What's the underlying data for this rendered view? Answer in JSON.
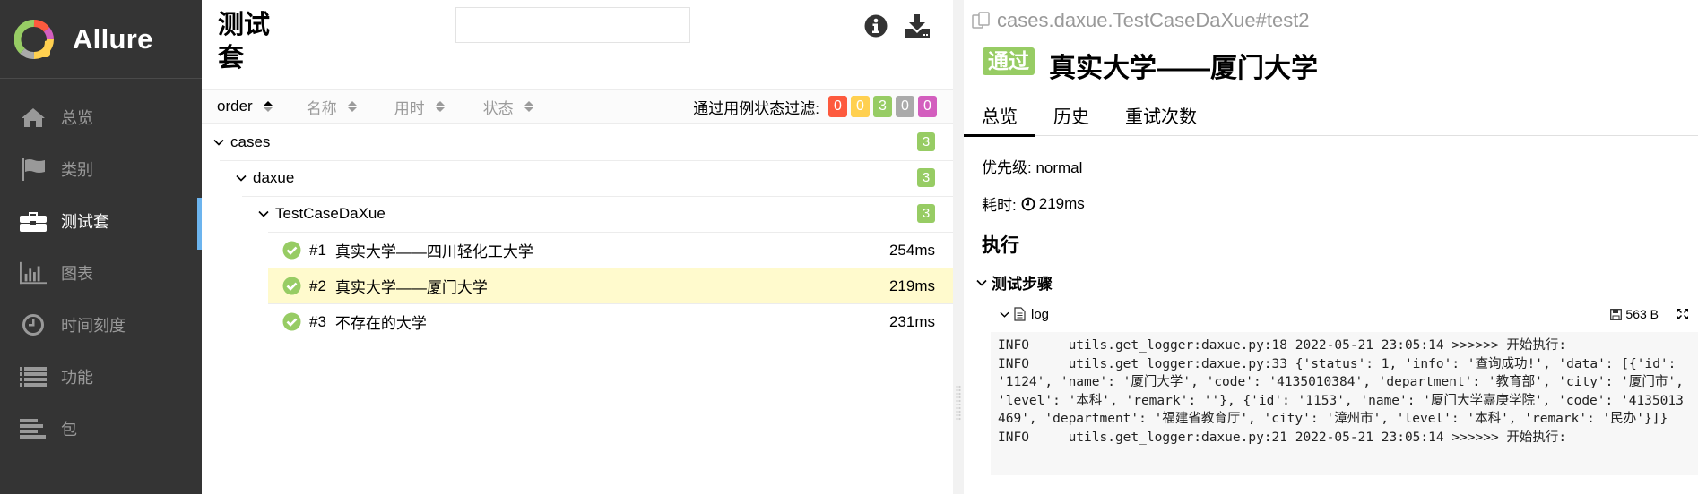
{
  "brand": {
    "name": "Allure"
  },
  "sidebar": {
    "items": [
      {
        "label": "总览",
        "icon": "home-icon"
      },
      {
        "label": "类别",
        "icon": "flag-icon"
      },
      {
        "label": "测试套",
        "icon": "briefcase-icon",
        "active": true
      },
      {
        "label": "图表",
        "icon": "bar-chart-icon"
      },
      {
        "label": "时间刻度",
        "icon": "clock-icon"
      },
      {
        "label": "功能",
        "icon": "list-icon"
      },
      {
        "label": "包",
        "icon": "align-left-icon"
      }
    ]
  },
  "suites": {
    "title": "测试套",
    "search": {
      "value": "",
      "placeholder": ""
    },
    "sort": {
      "columns": [
        {
          "label": "order",
          "active": true
        },
        {
          "label": "名称"
        },
        {
          "label": "用时"
        },
        {
          "label": "状态"
        }
      ]
    },
    "filter": {
      "label": "通过用例状态过滤:",
      "badges": [
        {
          "status": "failed",
          "count": "0",
          "color": "#fd5a3e"
        },
        {
          "status": "broken",
          "count": "0",
          "color": "#ffd050"
        },
        {
          "status": "passed",
          "count": "3",
          "color": "#97cc64"
        },
        {
          "status": "skipped",
          "count": "0",
          "color": "#aaaaaa"
        },
        {
          "status": "unknown",
          "count": "0",
          "color": "#d35ebe"
        }
      ]
    },
    "tree": [
      {
        "name": "cases",
        "count": "3"
      },
      {
        "name": "daxue",
        "count": "3"
      },
      {
        "name": "TestCaseDaXue",
        "count": "3"
      }
    ],
    "cases": [
      {
        "num": "#1",
        "name": "真实大学——四川轻化工大学",
        "duration": "254ms"
      },
      {
        "num": "#2",
        "name": "真实大学——厦门大学",
        "duration": "219ms",
        "selected": true
      },
      {
        "num": "#3",
        "name": "不存在的大学",
        "duration": "231ms"
      }
    ]
  },
  "detail": {
    "path": "cases.daxue.TestCaseDaXue#test2",
    "status": "通过",
    "title": "真实大学——厦门大学",
    "tabs": [
      {
        "label": "总览",
        "active": true
      },
      {
        "label": "历史"
      },
      {
        "label": "重试次数"
      }
    ],
    "severity": "优先级: normal",
    "duration_label": "耗时:",
    "duration": "219ms",
    "execution_heading": "执行",
    "steps_heading": "测试步骤",
    "attachment": {
      "name": "log",
      "size": "563 B"
    },
    "log": "INFO     utils.get_logger:daxue.py:18 2022-05-21 23:05:14 >>>>>> 开始执行:\nINFO     utils.get_logger:daxue.py:33 {'status': 1, 'info': '查询成功!', 'data': [{'id': '1124', 'name': '厦门大学', 'code': '4135010384', 'department': '教育部', 'city': '厦门市', 'level': '本科', 'remark': ''}, {'id': '1153', 'name': '厦门大学嘉庚学院', 'code': '4135013469', 'department': '福建省教育厅', 'city': '漳州市', 'level': '本科', 'remark': '民办'}]}\nINFO     utils.get_logger:daxue.py:21 2022-05-21 23:05:14 >>>>>> 开始执行:"
  }
}
